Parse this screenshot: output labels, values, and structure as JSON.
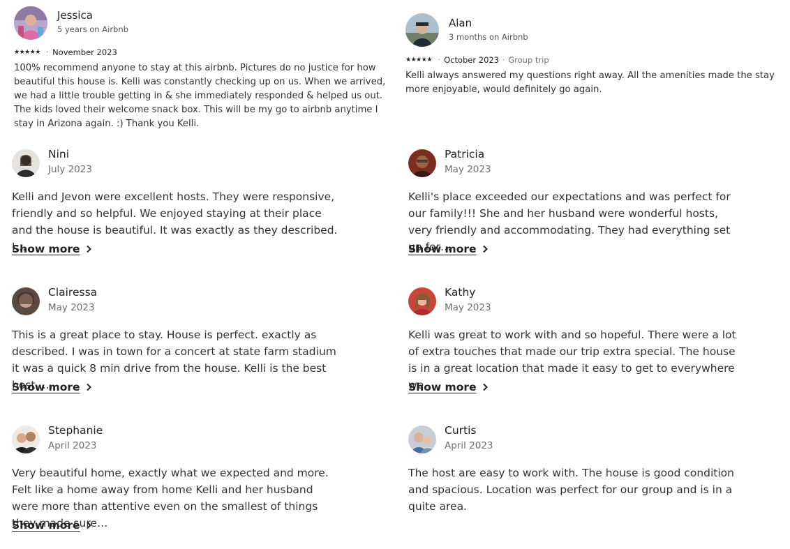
{
  "top_reviews": [
    {
      "name": "Jessica",
      "tenure": "5 years on Airbnb",
      "rating": 5,
      "date": "November 2023",
      "trip_type": "",
      "text": "100% recommend anyone to stay at this airbnb. Pictures do no justice for how beautiful this house is. Kelli was constantly checking up on us. When we arrived, we had a little trouble getting in & she immediately responded & helped us out. The kids loved their welcome snack box. This will be my go to airbnb anytime I stay in Arizona again. :) Thank you Kelli."
    },
    {
      "name": "Alan",
      "tenure": "3 months on Airbnb",
      "rating": 5,
      "date": "October 2023",
      "trip_type": "Group trip",
      "text": "Kelli always answered my questions right away. All the amenities made the stay more enjoyable, would definitely go again."
    }
  ],
  "reviews": [
    {
      "name": "Nini",
      "date": "July 2023",
      "text": "Kelli and Jevon were excellent hosts. They were responsive, friendly and so helpful. We enjoyed staying at their place and the house is beautiful. It was exactly as they described. I…",
      "show_more": "Show more"
    },
    {
      "name": "Patricia",
      "date": "May 2023",
      "text": "Kelli's place exceeded our expectations and was perfect for our family!!! She and her husband were wonderful hosts, very friendly and accommodating. They had everything set up for…",
      "show_more": "Show more"
    },
    {
      "name": "Clairessa",
      "date": "May 2023",
      "text": "This is a great place to stay. House is perfect. exactly as described. I was in town for a concert at state farm stadium it was a quick 8 min drive from the house. Kelli is the best host ….",
      "show_more": "Show more"
    },
    {
      "name": "Kathy",
      "date": "May 2023",
      "text": "Kelli was great to work with and so hopeful. There were a lot of extra touches that made our trip extra special. The house is in a great location that made it easy to get to everywhere we…",
      "show_more": "Show more"
    },
    {
      "name": "Stephanie",
      "date": "April 2023",
      "text": "Very beautiful home, exactly what we expected and more. Felt like a home away from home Kelli and her husband were more than attentive even on the smallest of things they made sure…",
      "show_more": "Show more"
    },
    {
      "name": "Curtis",
      "date": "April 2023",
      "text": "The host are easy to work with. The house is good condition and spacious. Location was perfect for our group and is in a quite area.",
      "show_more": ""
    }
  ],
  "icons": {
    "star": "star-icon",
    "chevron": "chevron-right-icon"
  },
  "colors": {
    "text_primary": "#222222",
    "text_secondary": "#717171"
  }
}
